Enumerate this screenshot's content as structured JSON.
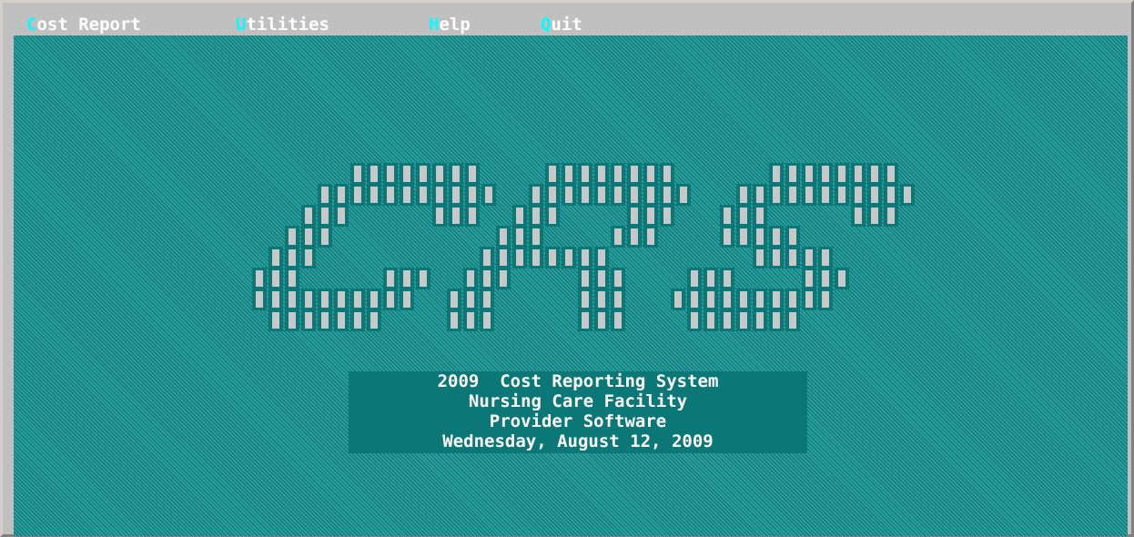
{
  "menu": [
    {
      "hotkey": "C",
      "rest": "ost Report"
    },
    {
      "hotkey": "U",
      "rest": "tilities"
    },
    {
      "hotkey": "H",
      "rest": "elp"
    },
    {
      "hotkey": "Q",
      "rest": "uit"
    }
  ],
  "logo": {
    "text": "CRS"
  },
  "info": {
    "line1": "2009  Cost Reporting System",
    "line2": "Nursing Care Facility",
    "line3": "Provider Software",
    "line4": "Wednesday, August 12, 2009"
  },
  "colors": {
    "desktop": "#1a8583",
    "menu_hotkey": "#00ffff",
    "menu_text": "#ffffff",
    "info_box": "#0b7877",
    "logo_block": "#c8c8c8"
  }
}
